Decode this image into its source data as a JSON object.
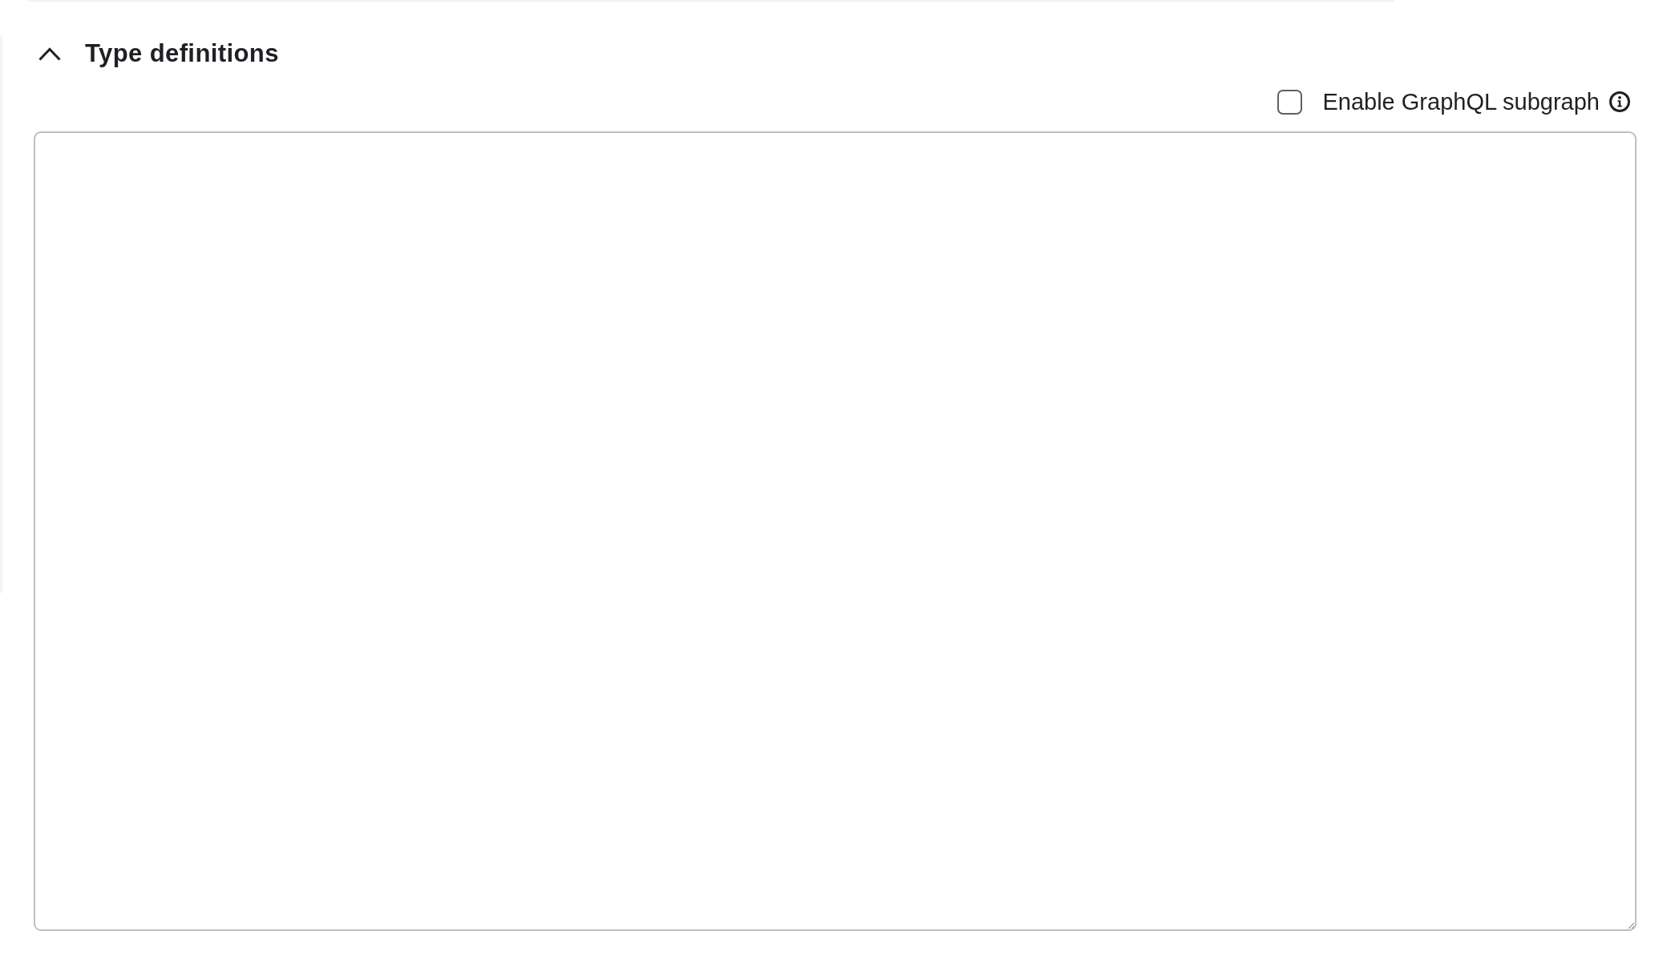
{
  "section": {
    "title": "Type definitions",
    "expanded": true
  },
  "subgraph_toggle": {
    "label": "Enable GraphQL subgraph",
    "checked": false
  }
}
